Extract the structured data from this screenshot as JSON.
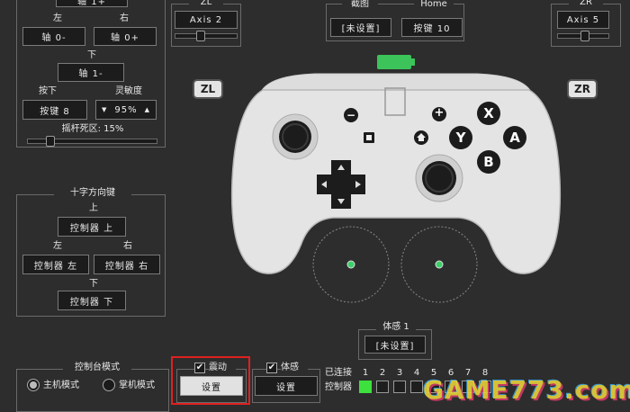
{
  "left_stick": {
    "top_value": "轴 1+",
    "left_label": "左",
    "right_label": "右",
    "left_value": "轴 0-",
    "right_value": "轴 0+",
    "down_label": "下",
    "down_value": "轴 1-",
    "press_label": "按下",
    "press_value": "按键 8",
    "sensitivity_label": "灵敏度",
    "sensitivity_value": "95%",
    "deadzone_label": "摇杆死区: 15%",
    "deadzone_level": 0.15
  },
  "zl": {
    "header": "ZL",
    "value": "Axis 2",
    "badge": "ZL",
    "slider_level": 0.4
  },
  "zr": {
    "header": "ZR",
    "value": "Axis 5",
    "badge": "ZR",
    "slider_level": 0.55
  },
  "capture": {
    "header": "截图",
    "value": "[未设置]"
  },
  "home": {
    "header": "Home",
    "value": "按键 10"
  },
  "dpad_group": {
    "title": "十字方向键",
    "up_label": "上",
    "up_value": "控制器 上",
    "left_label": "左",
    "left_value": "控制器 左",
    "right_label": "右",
    "right_value": "控制器 右",
    "down_label": "下",
    "down_value": "控制器 下"
  },
  "controller_buttons": {
    "x": "X",
    "y": "Y",
    "a": "A",
    "b": "B",
    "minus": "−",
    "plus": "+"
  },
  "motion": {
    "label": "体感 1",
    "value": "[未设置]"
  },
  "console_mode": {
    "title": "控制台模式",
    "docked": "主机模式",
    "handheld": "掌机模式",
    "selected": "docked"
  },
  "vibration": {
    "label": "震动",
    "checked": true,
    "button": "设置"
  },
  "motion_toggle": {
    "label": "体感",
    "checked": true,
    "button": "设置"
  },
  "connection": {
    "connected_label": "已连接",
    "controller_label": "控制器",
    "slots": [
      "1",
      "2",
      "3",
      "4",
      "5",
      "6",
      "7",
      "8"
    ],
    "active_slot": 1
  },
  "watermark": "GAME773.com",
  "colors": {
    "battery": "#3cc35a",
    "highlight": "#e02020",
    "active_slot": "#3ee03e"
  }
}
